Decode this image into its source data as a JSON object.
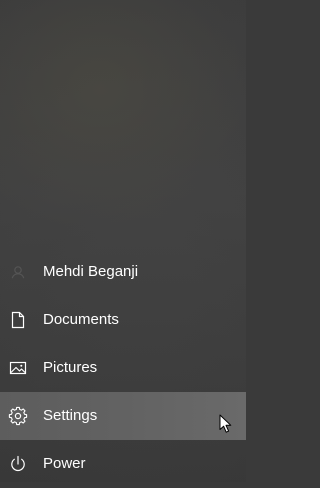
{
  "menu": {
    "items": [
      {
        "label": "Mehdi Beganji",
        "icon": "user-avatar-icon"
      },
      {
        "label": "Documents",
        "icon": "document-icon"
      },
      {
        "label": "Pictures",
        "icon": "pictures-icon"
      },
      {
        "label": "Settings",
        "icon": "gear-icon",
        "highlighted": true
      },
      {
        "label": "Power",
        "icon": "power-icon"
      }
    ]
  },
  "colors": {
    "background": "#3a3a3a",
    "highlight": "#626262",
    "text": "#ffffff"
  }
}
